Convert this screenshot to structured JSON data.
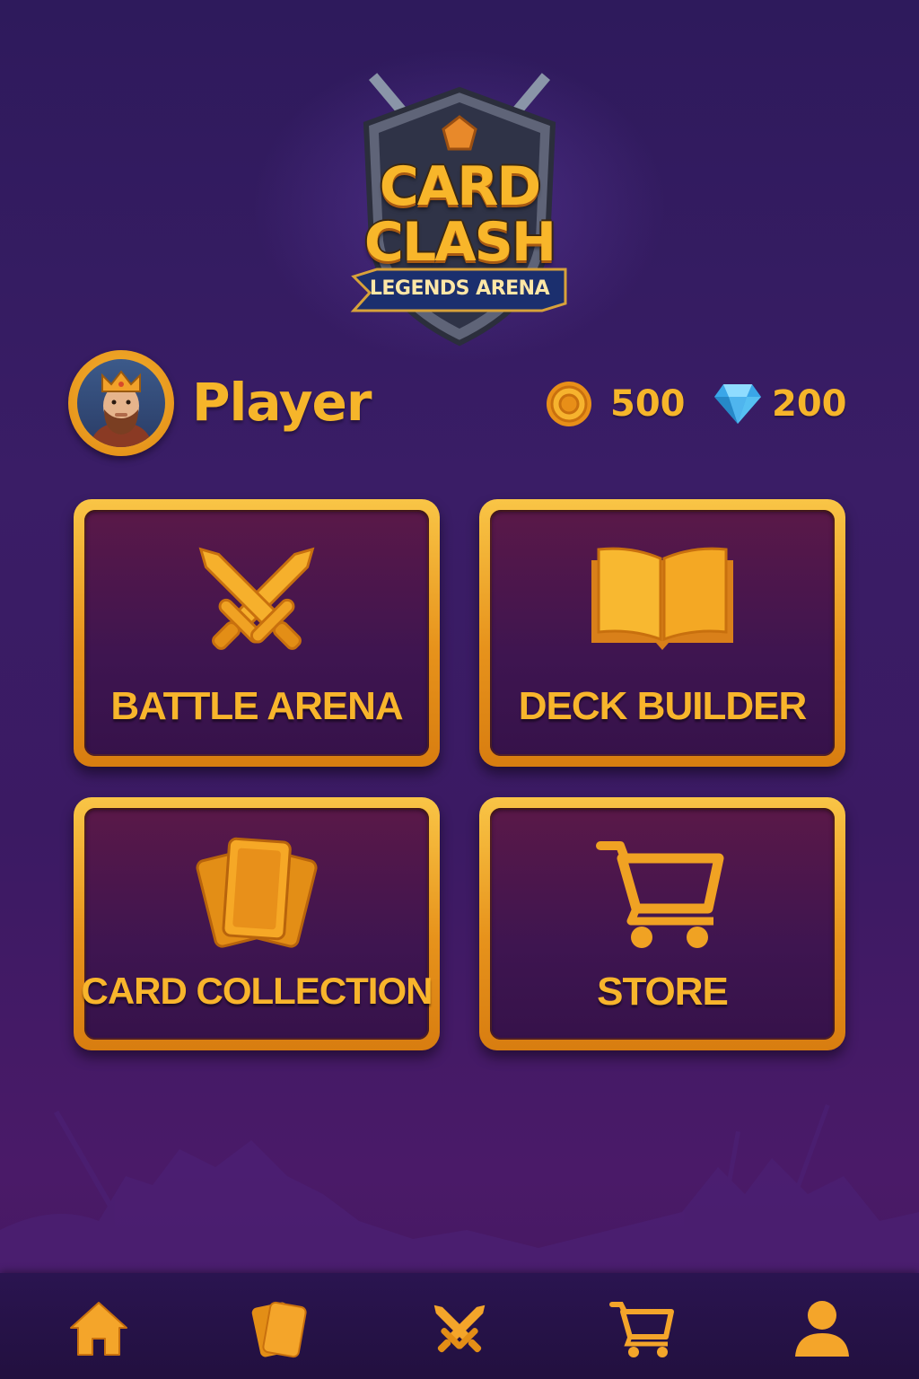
{
  "logo": {
    "title_line1": "CARD",
    "title_line2": "CLASH",
    "subtitle": "LEGENDS ARENA",
    "icon": "crossed-swords-shield-icon"
  },
  "player": {
    "name": "Player",
    "avatar": "king-avatar-icon"
  },
  "currency": {
    "coins": {
      "icon": "gold-coin-icon",
      "value": "500"
    },
    "gems": {
      "icon": "blue-diamond-icon",
      "value": "200"
    }
  },
  "menu": {
    "tiles": [
      {
        "label": "BATTLE ARENA",
        "icon": "crossed-swords-icon"
      },
      {
        "label": "DECK BUILDER",
        "icon": "open-book-icon"
      },
      {
        "label": "CARD COLLECTION",
        "icon": "card-stack-icon"
      },
      {
        "label": "STORE",
        "icon": "shopping-cart-icon"
      }
    ]
  },
  "bottom_nav": {
    "items": [
      {
        "icon": "home-icon"
      },
      {
        "icon": "cards-icon"
      },
      {
        "icon": "crossed-swords-icon"
      },
      {
        "icon": "shopping-cart-icon"
      },
      {
        "icon": "profile-icon"
      }
    ]
  },
  "colors": {
    "accent_gold": "#f6b52a",
    "tile_border": "#e7931c",
    "tile_fill": "#4a1650",
    "background": "#3a1d66",
    "gem_blue": "#4fc3f7"
  }
}
